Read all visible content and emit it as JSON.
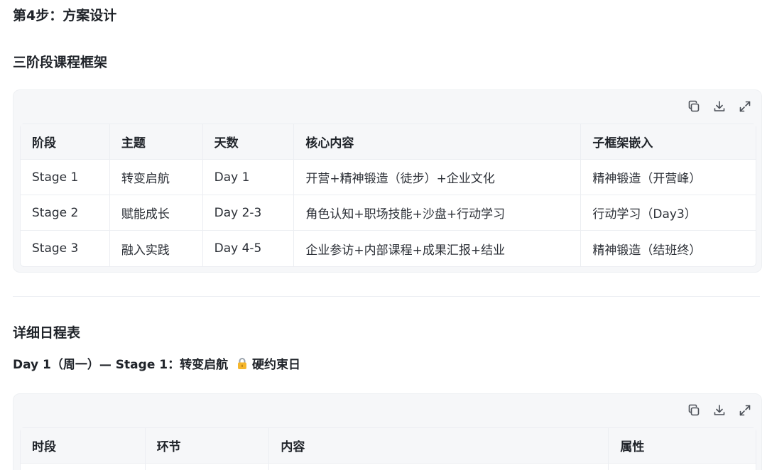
{
  "step_title": "第4步：方案设计",
  "section1_title": "三阶段课程框架",
  "table1": {
    "headers": [
      "阶段",
      "主题",
      "天数",
      "核心内容",
      "子框架嵌入"
    ],
    "rows": [
      [
        "Stage 1",
        "转变启航",
        "Day 1",
        "开营+精神锻造（徒步）+企业文化",
        "精神锻造（开营峰）"
      ],
      [
        "Stage 2",
        "赋能成长",
        "Day 2-3",
        "角色认知+职场技能+沙盘+行动学习",
        "行动学习（Day3）"
      ],
      [
        "Stage 3",
        "融入实践",
        "Day 4-5",
        "企业参访+内部课程+成果汇报+结业",
        "精神锻造（结班终）"
      ]
    ]
  },
  "section2_title": "详细日程表",
  "day1_title": "Day 1（周一）— Stage 1：转变启航",
  "day1_tag": "硬约束日",
  "table2": {
    "headers": [
      "时段",
      "环节",
      "内容",
      "属性"
    ],
    "rows": [
      [
        "",
        "",
        "",
        ""
      ]
    ]
  },
  "toolbar": {
    "icons": [
      "copy-icon",
      "download-icon",
      "expand-icon"
    ]
  }
}
